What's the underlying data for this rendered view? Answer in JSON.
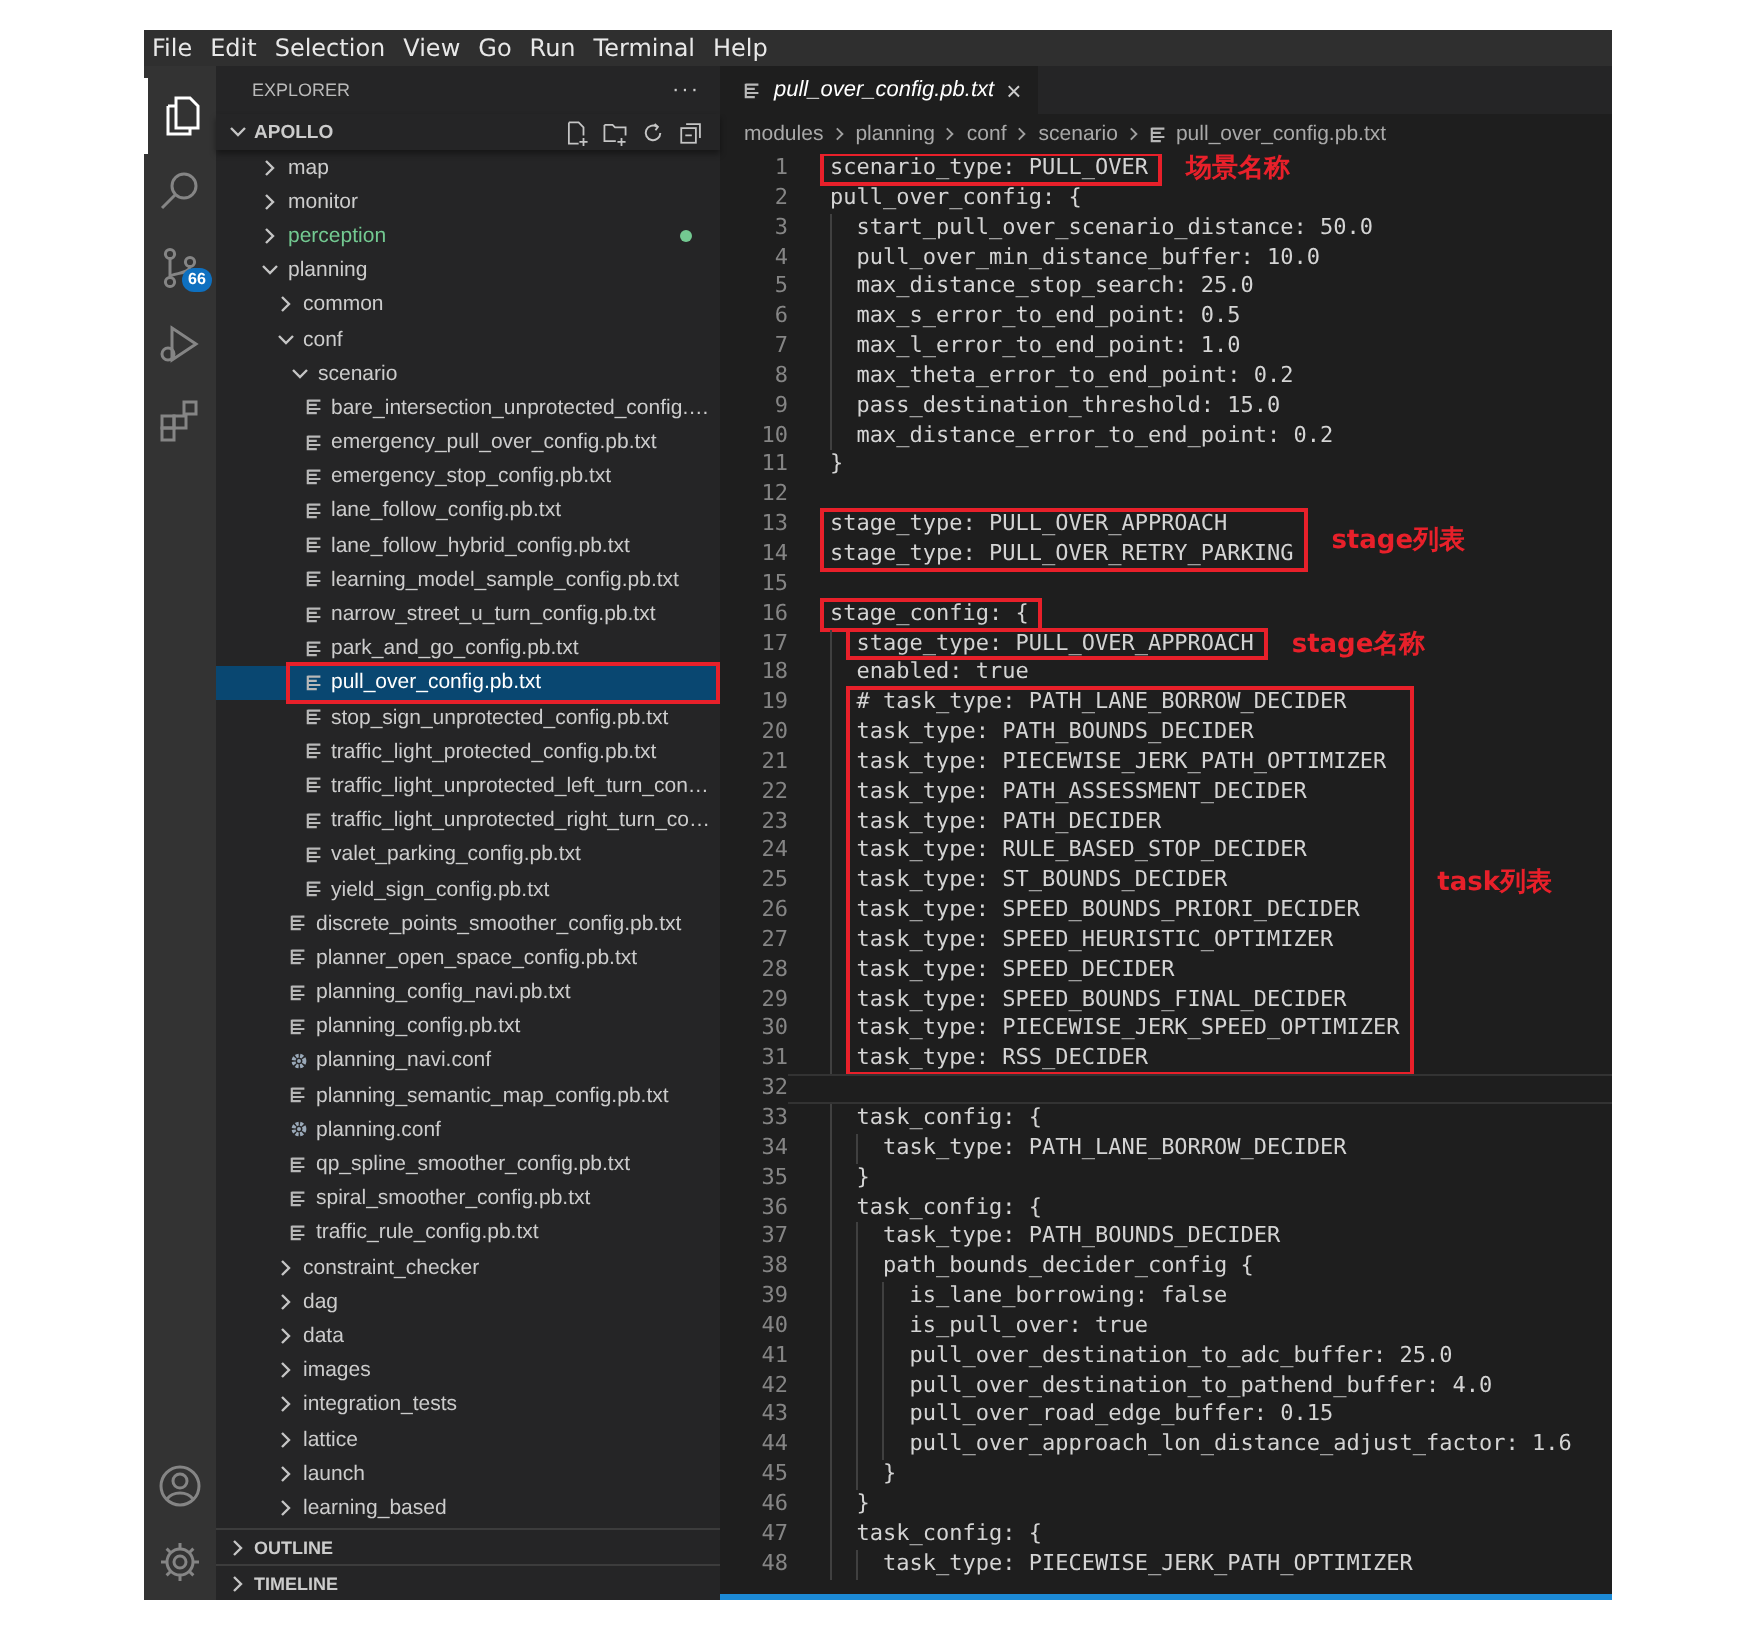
{
  "menu": [
    "File",
    "Edit",
    "Selection",
    "View",
    "Go",
    "Run",
    "Terminal",
    "Help"
  ],
  "activity_bar": {
    "top": [
      {
        "kind": "explorer",
        "selected": true
      },
      {
        "kind": "search",
        "selected": false
      },
      {
        "kind": "source-control",
        "selected": false,
        "badge": "66"
      },
      {
        "kind": "run",
        "selected": false
      },
      {
        "kind": "extensions",
        "selected": false
      }
    ],
    "bottom": [
      {
        "kind": "account"
      },
      {
        "kind": "settings"
      }
    ]
  },
  "sidebar": {
    "title": "EXPLORER",
    "more": "···",
    "root": {
      "name": "APOLLO",
      "expanded": true
    },
    "selection_annotated": true,
    "tree": [
      {
        "name": "map",
        "kind": "folder",
        "expanded": false,
        "selected": false,
        "modified": false
      },
      {
        "name": "monitor",
        "kind": "folder",
        "expanded": false,
        "selected": false,
        "modified": false
      },
      {
        "name": "perception",
        "kind": "folder",
        "expanded": false,
        "selected": false,
        "modified": true
      },
      {
        "name": "planning",
        "kind": "folder",
        "expanded": true,
        "selected": false,
        "modified": false,
        "children": [
          {
            "name": "common",
            "kind": "folder",
            "expanded": false,
            "selected": false
          },
          {
            "name": "conf",
            "kind": "folder",
            "expanded": true,
            "selected": false,
            "children": [
              {
                "name": "scenario",
                "kind": "folder",
                "expanded": true,
                "selected": false,
                "children": [
                  {
                    "name": "bare_intersection_unprotected_config.…",
                    "kind": "file",
                    "selected": false
                  },
                  {
                    "name": "emergency_pull_over_config.pb.txt",
                    "kind": "file",
                    "selected": false
                  },
                  {
                    "name": "emergency_stop_config.pb.txt",
                    "kind": "file",
                    "selected": false
                  },
                  {
                    "name": "lane_follow_config.pb.txt",
                    "kind": "file",
                    "selected": false
                  },
                  {
                    "name": "lane_follow_hybrid_config.pb.txt",
                    "kind": "file",
                    "selected": false
                  },
                  {
                    "name": "learning_model_sample_config.pb.txt",
                    "kind": "file",
                    "selected": false
                  },
                  {
                    "name": "narrow_street_u_turn_config.pb.txt",
                    "kind": "file",
                    "selected": false
                  },
                  {
                    "name": "park_and_go_config.pb.txt",
                    "kind": "file",
                    "selected": false
                  },
                  {
                    "name": "pull_over_config.pb.txt",
                    "kind": "file",
                    "selected": true
                  },
                  {
                    "name": "stop_sign_unprotected_config.pb.txt",
                    "kind": "file",
                    "selected": false
                  },
                  {
                    "name": "traffic_light_protected_config.pb.txt",
                    "kind": "file",
                    "selected": false
                  },
                  {
                    "name": "traffic_light_unprotected_left_turn_con…",
                    "kind": "file",
                    "selected": false
                  },
                  {
                    "name": "traffic_light_unprotected_right_turn_co…",
                    "kind": "file",
                    "selected": false
                  },
                  {
                    "name": "valet_parking_config.pb.txt",
                    "kind": "file",
                    "selected": false
                  },
                  {
                    "name": "yield_sign_config.pb.txt",
                    "kind": "file",
                    "selected": false
                  }
                ]
              },
              {
                "name": "discrete_points_smoother_config.pb.txt",
                "kind": "file",
                "selected": false
              },
              {
                "name": "planner_open_space_config.pb.txt",
                "kind": "file",
                "selected": false
              },
              {
                "name": "planning_config_navi.pb.txt",
                "kind": "file",
                "selected": false
              },
              {
                "name": "planning_config.pb.txt",
                "kind": "file",
                "selected": false
              },
              {
                "name": "planning_navi.conf",
                "kind": "settings-file",
                "selected": false
              },
              {
                "name": "planning_semantic_map_config.pb.txt",
                "kind": "file",
                "selected": false
              },
              {
                "name": "planning.conf",
                "kind": "settings-file",
                "selected": false
              },
              {
                "name": "qp_spline_smoother_config.pb.txt",
                "kind": "file",
                "selected": false
              },
              {
                "name": "spiral_smoother_config.pb.txt",
                "kind": "file",
                "selected": false
              },
              {
                "name": "traffic_rule_config.pb.txt",
                "kind": "file",
                "selected": false
              }
            ]
          },
          {
            "name": "constraint_checker",
            "kind": "folder",
            "expanded": false,
            "selected": false
          },
          {
            "name": "dag",
            "kind": "folder",
            "expanded": false,
            "selected": false
          },
          {
            "name": "data",
            "kind": "folder",
            "expanded": false,
            "selected": false
          },
          {
            "name": "images",
            "kind": "folder",
            "expanded": false,
            "selected": false
          },
          {
            "name": "integration_tests",
            "kind": "folder",
            "expanded": false,
            "selected": false
          },
          {
            "name": "lattice",
            "kind": "folder",
            "expanded": false,
            "selected": false
          },
          {
            "name": "launch",
            "kind": "folder",
            "expanded": false,
            "selected": false
          },
          {
            "name": "learning_based",
            "kind": "folder",
            "expanded": false,
            "selected": false
          }
        ]
      }
    ],
    "panels": [
      {
        "name": "OUTLINE",
        "expanded": false
      },
      {
        "name": "TIMELINE",
        "expanded": false
      }
    ]
  },
  "editor": {
    "tab": {
      "title": "pull_over_config.pb.txt",
      "close": "×",
      "preview": true
    },
    "breadcrumbs": [
      "modules",
      "planning",
      "conf",
      "scenario",
      "pull_over_config.pb.txt"
    ],
    "blocks": [
      {
        "boxed": true,
        "current": false,
        "note": "场景名称",
        "lines": [
          {
            "n": "1",
            "text": "scenario_type: PULL_OVER"
          }
        ]
      },
      {
        "boxed": false,
        "current": false,
        "lines": [
          {
            "n": "2",
            "text": "pull_over_config: {"
          },
          {
            "n": "3",
            "text": "  start_pull_over_scenario_distance: 50.0"
          },
          {
            "n": "4",
            "text": "  pull_over_min_distance_buffer: 10.0"
          },
          {
            "n": "5",
            "text": "  max_distance_stop_search: 25.0"
          },
          {
            "n": "6",
            "text": "  max_s_error_to_end_point: 0.5"
          },
          {
            "n": "7",
            "text": "  max_l_error_to_end_point: 1.0"
          },
          {
            "n": "8",
            "text": "  max_theta_error_to_end_point: 0.2"
          },
          {
            "n": "9",
            "text": "  pass_destination_threshold: 15.0"
          },
          {
            "n": "10",
            "text": "  max_distance_error_to_end_point: 0.2"
          },
          {
            "n": "11",
            "text": "}"
          },
          {
            "n": "12"
          }
        ]
      },
      {
        "boxed": true,
        "current": false,
        "note": "stage列表",
        "lines": [
          {
            "n": "13",
            "text": "stage_type: PULL_OVER_APPROACH"
          },
          {
            "n": "14",
            "text": "stage_type: PULL_OVER_RETRY_PARKING"
          }
        ]
      },
      {
        "boxed": false,
        "current": false,
        "lines": [
          {
            "n": "15"
          }
        ]
      },
      {
        "boxed": true,
        "current": false,
        "lines": [
          {
            "n": "16",
            "text": "stage_config: {"
          }
        ]
      },
      {
        "boxed": true,
        "current": false,
        "note": "stage名称",
        "lines": [
          {
            "n": "17",
            "text": "  stage_type: PULL_OVER_APPROACH"
          }
        ]
      },
      {
        "boxed": false,
        "current": false,
        "lines": [
          {
            "n": "18",
            "text": "  enabled: true"
          }
        ]
      },
      {
        "boxed": true,
        "current": false,
        "note": "task列表",
        "lines": [
          {
            "n": "19",
            "text": "  # task_type: PATH_LANE_BORROW_DECIDER"
          },
          {
            "n": "20",
            "text": "  task_type: PATH_BOUNDS_DECIDER"
          },
          {
            "n": "21",
            "text": "  task_type: PIECEWISE_JERK_PATH_OPTIMIZER"
          },
          {
            "n": "22",
            "text": "  task_type: PATH_ASSESSMENT_DECIDER"
          },
          {
            "n": "23",
            "text": "  task_type: PATH_DECIDER"
          },
          {
            "n": "24",
            "text": "  task_type: RULE_BASED_STOP_DECIDER"
          },
          {
            "n": "25",
            "text": "  task_type: ST_BOUNDS_DECIDER"
          },
          {
            "n": "26",
            "text": "  task_type: SPEED_BOUNDS_PRIORI_DECIDER"
          },
          {
            "n": "27",
            "text": "  task_type: SPEED_HEURISTIC_OPTIMIZER"
          },
          {
            "n": "28",
            "text": "  task_type: SPEED_DECIDER"
          },
          {
            "n": "29",
            "text": "  task_type: SPEED_BOUNDS_FINAL_DECIDER"
          },
          {
            "n": "30",
            "text": "  task_type: PIECEWISE_JERK_SPEED_OPTIMIZER"
          },
          {
            "n": "31",
            "text": "  task_type: RSS_DECIDER"
          }
        ]
      },
      {
        "boxed": false,
        "current": true,
        "lines": [
          {
            "n": "32"
          }
        ]
      },
      {
        "boxed": false,
        "current": false,
        "lines": [
          {
            "n": "33",
            "text": "  task_config: {"
          },
          {
            "n": "34",
            "text": "    task_type: PATH_LANE_BORROW_DECIDER"
          },
          {
            "n": "35",
            "text": "  }"
          },
          {
            "n": "36",
            "text": "  task_config: {"
          },
          {
            "n": "37",
            "text": "    task_type: PATH_BOUNDS_DECIDER"
          },
          {
            "n": "38",
            "text": "    path_bounds_decider_config {"
          },
          {
            "n": "39",
            "text": "      is_lane_borrowing: false"
          },
          {
            "n": "40",
            "text": "      is_pull_over: true"
          },
          {
            "n": "41",
            "text": "      pull_over_destination_to_adc_buffer: 25.0"
          },
          {
            "n": "42",
            "text": "      pull_over_destination_to_pathend_buffer: 4.0"
          },
          {
            "n": "43",
            "text": "      pull_over_road_edge_buffer: 0.15"
          },
          {
            "n": "44",
            "text": "      pull_over_approach_lon_distance_adjust_factor: 1.6"
          },
          {
            "n": "45",
            "text": "    }"
          },
          {
            "n": "46",
            "text": "  }"
          },
          {
            "n": "47",
            "text": "  task_config: {"
          },
          {
            "n": "48",
            "text": "    task_type: PIECEWISE_JERK_PATH_OPTIMIZER"
          }
        ]
      }
    ]
  }
}
